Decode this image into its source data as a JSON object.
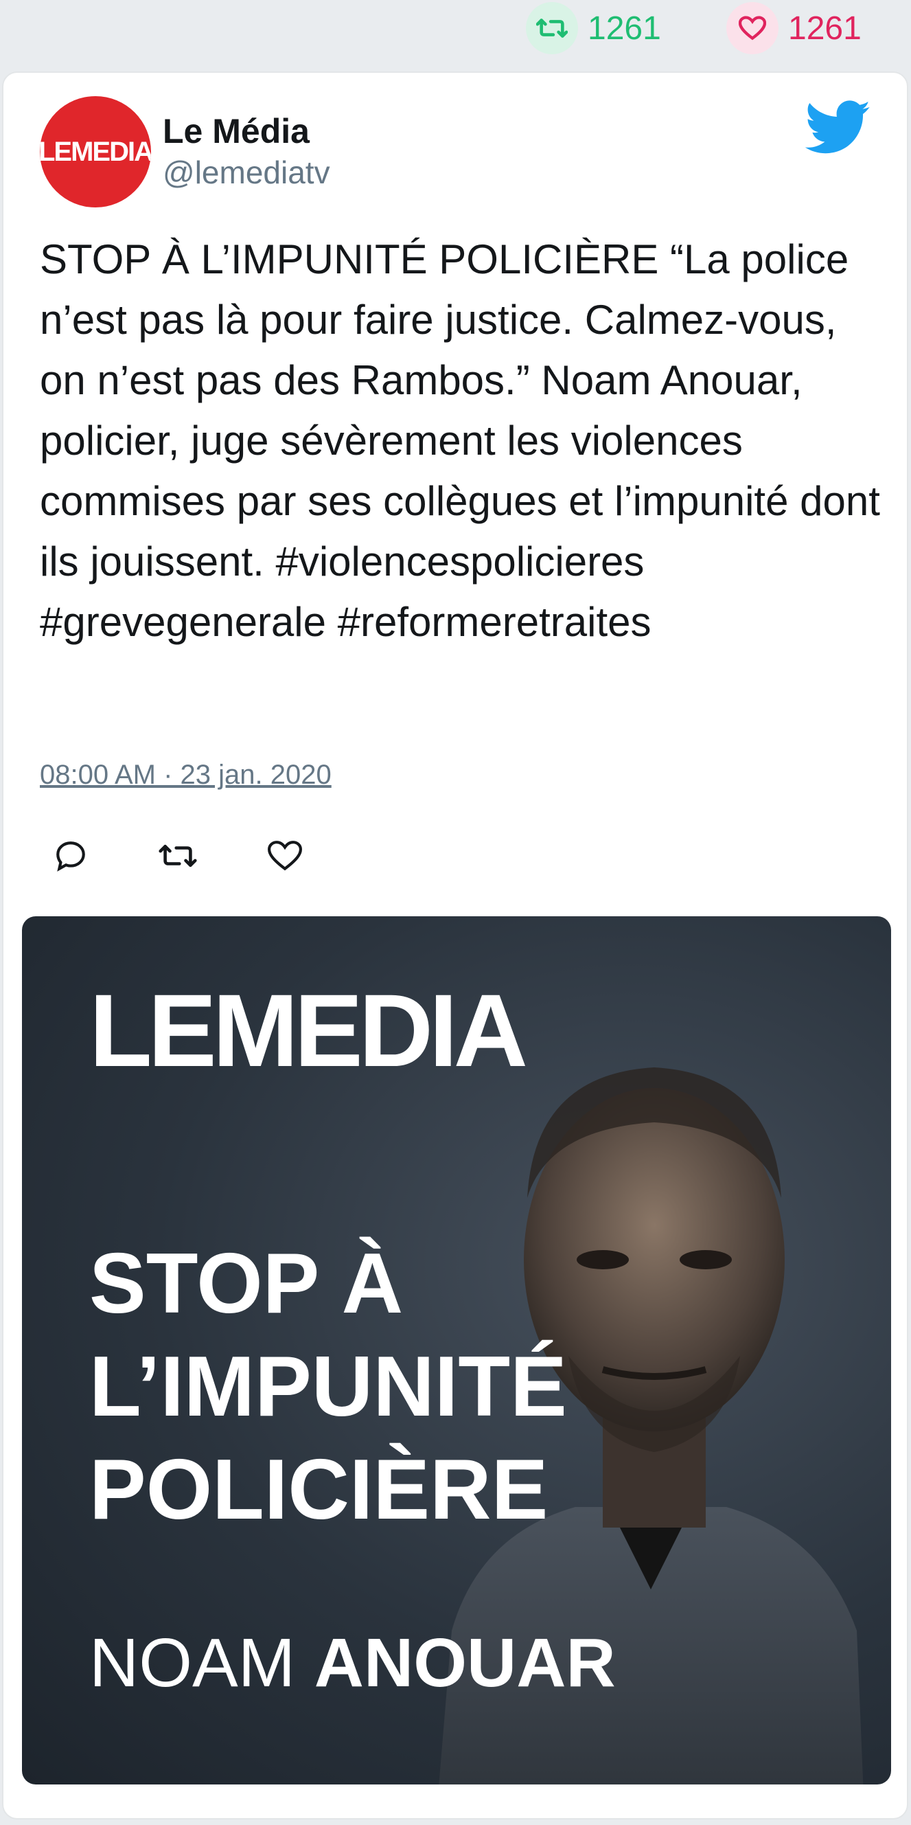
{
  "stats": {
    "retweets": "1261",
    "likes": "1261",
    "retweet_color": "#1fbd72",
    "like_color": "#e0245e"
  },
  "tweet": {
    "author_name": "Le Média",
    "author_handle": "@lemediatv",
    "avatar_text": "LEMEDIA",
    "text": "STOP À L’IMPUNITÉ POLICIÈRE “La police n’est pas là pour faire justice. Calmez-vous, on n’est pas des Rambos.” Noam Anouar, policier, juge sévèrement les violences commises par ses collègues et l’impunité dont ils jouissent. #violencespolicieres #grevegenerale #reformeretraites",
    "timestamp": "08:00 AM · 23 jan. 2020"
  },
  "actions": {
    "reply_icon": "reply-icon",
    "retweet_icon": "retweet-icon",
    "like_icon": "heart-icon"
  },
  "media": {
    "logo": "LEMEDIA",
    "headline": "STOP À\nL’IMPUNITÉ\nPOLICIÈRE",
    "name_first": "NOAM",
    "name_last": "ANOUAR"
  }
}
